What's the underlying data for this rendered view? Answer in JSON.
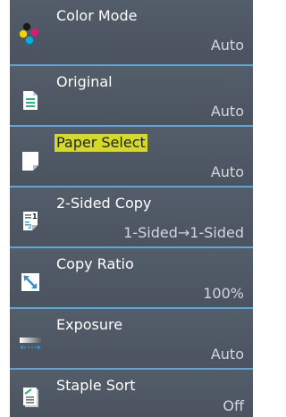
{
  "menu": {
    "items": [
      {
        "label": "Color Mode",
        "value": "Auto",
        "icon": "color-dots-icon"
      },
      {
        "label": "Original",
        "value": "Auto",
        "icon": "original-document-icon"
      },
      {
        "label": "Paper Select",
        "value": "Auto",
        "icon": "paper-sheet-icon",
        "highlighted": true
      },
      {
        "label": "2-Sided Copy",
        "value": "1-Sided→1-Sided",
        "icon": "duplex-copy-icon"
      },
      {
        "label": "Copy Ratio",
        "value": "100%",
        "icon": "copy-ratio-icon"
      },
      {
        "label": "Exposure",
        "value": "Auto",
        "icon": "exposure-icon"
      },
      {
        "label": "Staple Sort",
        "value": "Off",
        "icon": "staple-sort-icon"
      }
    ]
  },
  "colors": {
    "item_background": "#4e5764",
    "separator": "#5ea6d4",
    "highlight": "#e3e61d"
  }
}
